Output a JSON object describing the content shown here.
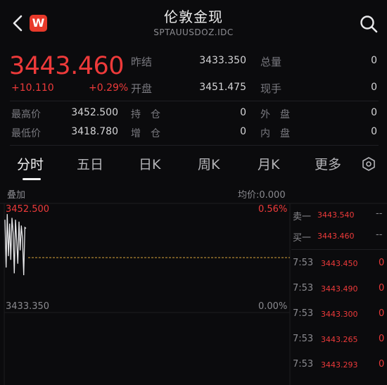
{
  "header": {
    "title": "伦敦金现",
    "subtitle": "SPTAUUSDOZ.IDC",
    "logo_text": "W"
  },
  "quote": {
    "price": "3443.460",
    "change": "+10.110",
    "change_pct": "+0.29%",
    "stats": [
      {
        "label": "昨结",
        "value": "3433.350"
      },
      {
        "label": "开盘",
        "value": "3451.475"
      },
      {
        "label": "总量",
        "value": "0"
      },
      {
        "label": "现手",
        "value": "0"
      },
      {
        "label": "最高价",
        "value": "3452.500"
      },
      {
        "label": "最低价",
        "value": "3418.780"
      },
      {
        "label": "持　仓",
        "value": "0"
      },
      {
        "label": "增　仓",
        "value": "0"
      },
      {
        "label": "外　盘",
        "value": "0"
      },
      {
        "label": "内　盘",
        "value": "0"
      }
    ]
  },
  "tabs": [
    {
      "label": "分时",
      "active": true
    },
    {
      "label": "五日"
    },
    {
      "label": "日K"
    },
    {
      "label": "周K"
    },
    {
      "label": "月K"
    },
    {
      "label": "更多"
    }
  ],
  "chart": {
    "overlay_label": "叠加",
    "avg_label": "均价:0.000",
    "high_label": "3452.500",
    "high_pct": "0.56%",
    "base_label": "3433.350",
    "base_pct": "0.00%"
  },
  "chart_data": {
    "type": "line",
    "y_range": [
      3414.2,
      3452.5
    ],
    "reference": 3433.35,
    "series": [
      {
        "values": [
          3448.0,
          3423.0,
          3451.0,
          3429.0,
          3446.0,
          3427.0,
          3449.0,
          3441.0,
          3420.0,
          3448.0,
          3437.0,
          3425.0,
          3447.0,
          3432.0,
          3445.0,
          3438.0,
          3419.0,
          3444.0,
          3443.46
        ]
      }
    ]
  },
  "orderbook": {
    "sell_label": "卖一",
    "sell_price": "3443.540",
    "sell_vol": "--",
    "buy_label": "买一",
    "buy_price": "3443.460",
    "buy_vol": "--"
  },
  "ticks": [
    {
      "time": "7:53",
      "price": "3443.450",
      "vol": "0"
    },
    {
      "time": "7:53",
      "price": "3443.490",
      "vol": "0"
    },
    {
      "time": "7:53",
      "price": "3443.300",
      "vol": "0"
    },
    {
      "time": "7:53",
      "price": "3443.265",
      "vol": "0"
    },
    {
      "time": "7:53",
      "price": "3443.293",
      "vol": "0"
    }
  ],
  "colors": {
    "up": "#ee3a3a",
    "background": "#0b0b0d",
    "ref_line": "#d8a43a"
  }
}
